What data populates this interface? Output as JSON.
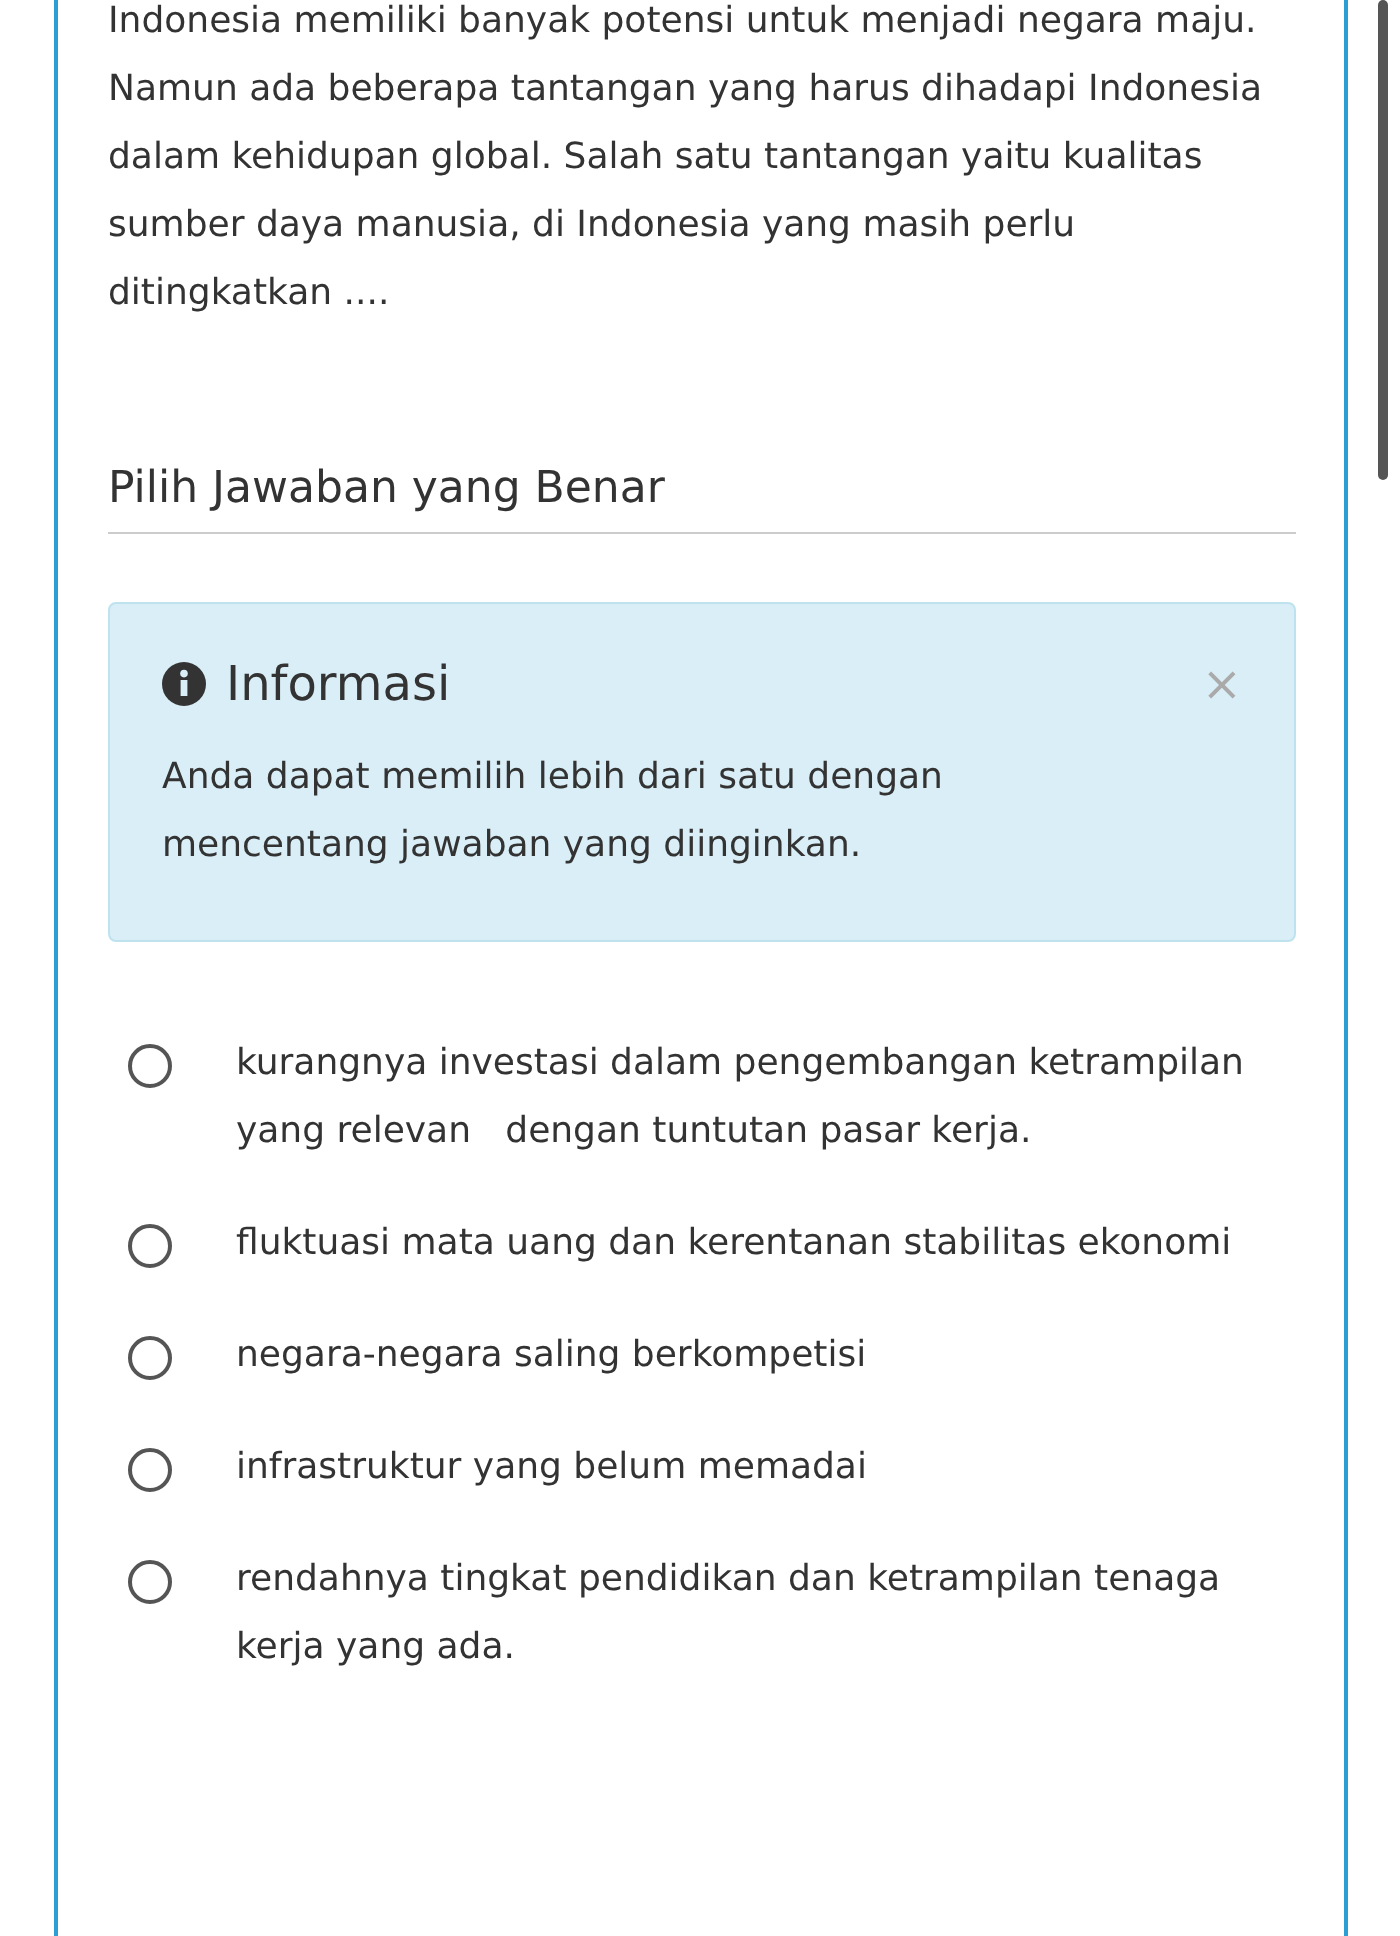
{
  "question": "Indonesia memiliki banyak potensi untuk menjadi negara maju. Namun ada beberapa tantangan yang harus dihadapi Indonesia dalam kehidupan global. Salah satu tantangan yaitu kualitas sumber daya manusia, di Indonesia yang masih perlu ditingkatkan ....",
  "section_title": "Pilih Jawaban yang Benar",
  "info": {
    "title": "Informasi",
    "close": "×",
    "body": "Anda dapat memilih lebih dari satu dengan mencentang jawaban yang diinginkan."
  },
  "options": [
    {
      "label": "kurangnya investasi dalam pengembangan ketrampilan yang relevan   dengan tuntutan pasar kerja.",
      "selected": false
    },
    {
      "label": "fluktuasi mata uang dan kerentanan stabilitas ekonomi",
      "selected": false
    },
    {
      "label": "negara-negara saling berkompetisi",
      "selected": false
    },
    {
      "label": "infrastruktur yang belum memadai",
      "selected": false
    },
    {
      "label": "rendahnya tingkat pendidikan dan ketrampilan tenaga kerja yang ada.",
      "selected": false
    }
  ]
}
